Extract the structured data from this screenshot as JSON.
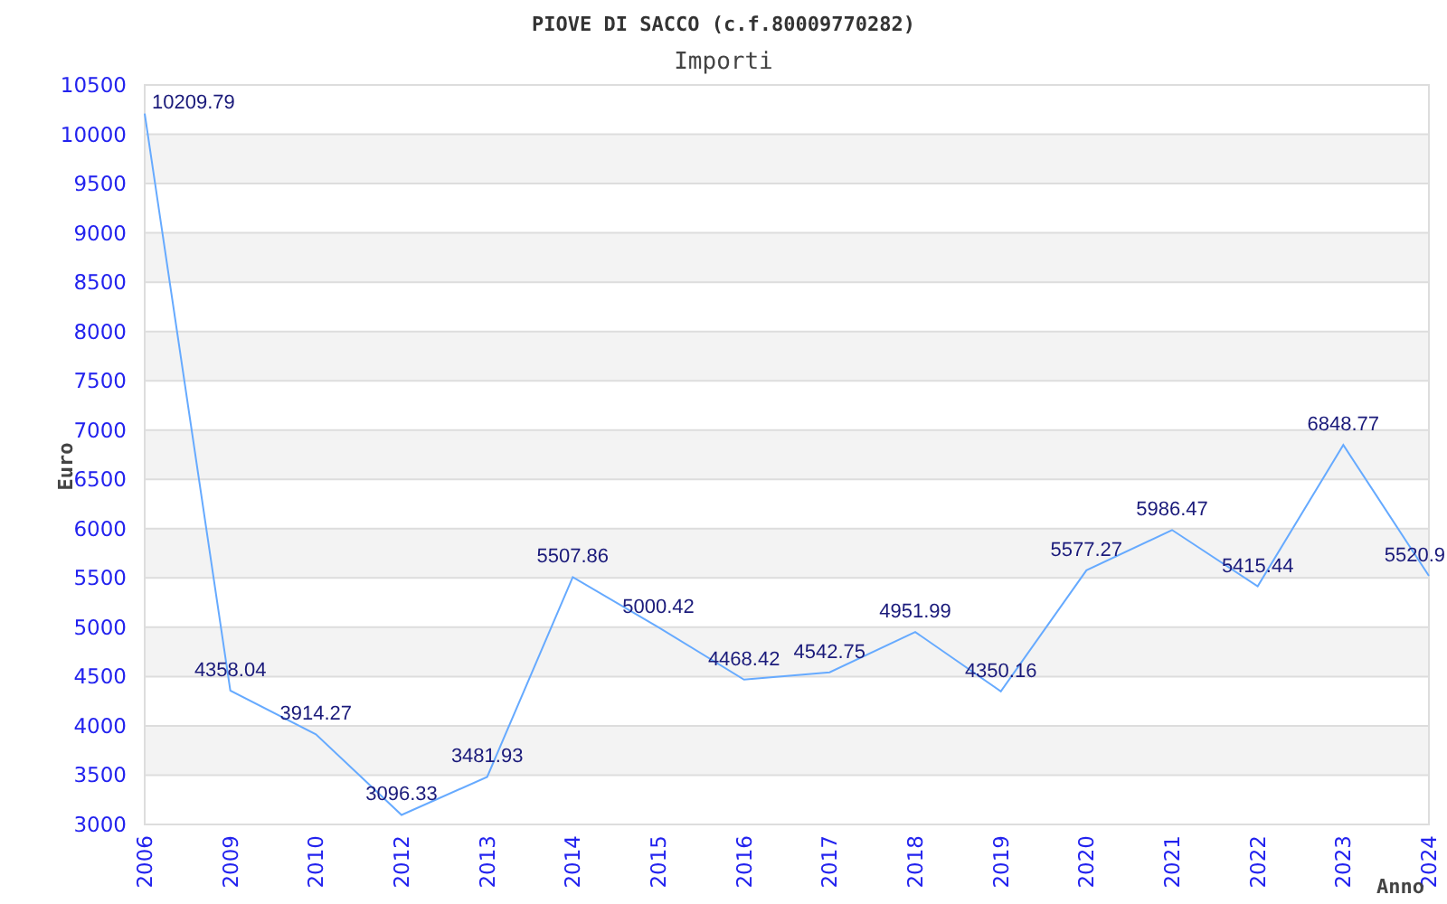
{
  "title": "PIOVE DI SACCO (c.f.80009770282)",
  "chart_data": {
    "type": "line",
    "title": "Importi",
    "xlabel": "Anno",
    "ylabel": "Euro",
    "categories": [
      "2006",
      "2009",
      "2010",
      "2012",
      "2013",
      "2014",
      "2015",
      "2016",
      "2017",
      "2018",
      "2019",
      "2020",
      "2021",
      "2022",
      "2023",
      "2024"
    ],
    "grid": true,
    "series": [
      {
        "color": "#66aaff",
        "values": [
          10209.79,
          4358.04,
          3914.27,
          3096.33,
          3481.93,
          5507.86,
          5000.42,
          4468.42,
          4542.75,
          4951.99,
          4350.16,
          5577.27,
          5986.47,
          5415.44,
          6848.77,
          5520.9
        ]
      }
    ],
    "value_labels": [
      "10209.79",
      "4358.04",
      "3914.27",
      "3096.33",
      "3481.93",
      "5507.86",
      "5000.42",
      "4468.42",
      "4542.75",
      "4951.99",
      "4350.16",
      "5577.27",
      "5986.47",
      "5415.44",
      "6848.77",
      "5520.9"
    ],
    "ylim": [
      3000,
      10500
    ],
    "yticks": [
      3000,
      3500,
      4000,
      4500,
      5000,
      5500,
      6000,
      6500,
      7000,
      7500,
      8000,
      8500,
      9000,
      9500,
      10000,
      10500
    ]
  }
}
